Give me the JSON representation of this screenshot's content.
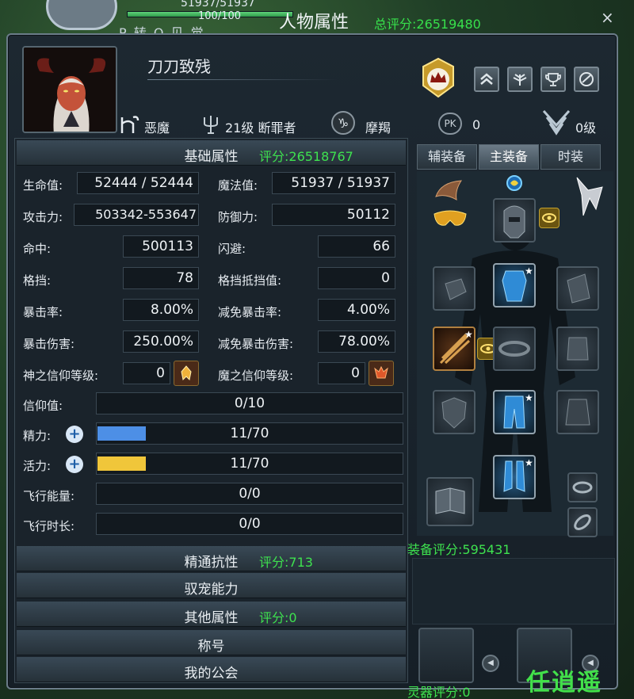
{
  "overlay": {
    "hp_text": "51937/51937",
    "mp_text": "100/100",
    "name_partial": "P 转 Q 见 觉"
  },
  "window": {
    "title": "人物属性",
    "total_score": "总评分:26519480",
    "close_label": "×"
  },
  "character": {
    "name": "刀刀致残",
    "race": "恶魔",
    "class": "21级 断罪者",
    "zodiac": "摩羯",
    "pk_label": "PK",
    "pk_value": "0",
    "rank_value": "0级"
  },
  "basic": {
    "title": "基础属性",
    "score": "评分:26518767",
    "stats": [
      {
        "label": "生命值:",
        "value": "52444 / 52444"
      },
      {
        "label": "魔法值:",
        "value": "51937 / 51937"
      },
      {
        "label": "攻击力:",
        "value": "503342-553647"
      },
      {
        "label": "防御力:",
        "value": "50112"
      },
      {
        "label": "命中:",
        "value": "500113"
      },
      {
        "label": "闪避:",
        "value": "66"
      },
      {
        "label": "格挡:",
        "value": "78"
      },
      {
        "label": "格挡抵挡值:",
        "value": "0"
      },
      {
        "label": "暴击率:",
        "value": "8.00%"
      },
      {
        "label": "减免暴击率:",
        "value": "4.00%"
      },
      {
        "label": "暴击伤害:",
        "value": "250.00%"
      },
      {
        "label": "减免暴击伤害:",
        "value": "78.00%"
      },
      {
        "label": "神之信仰等级:",
        "value": "0"
      },
      {
        "label": "魔之信仰等级:",
        "value": "0"
      }
    ],
    "faith": {
      "label": "信仰值:",
      "value": "0/10"
    },
    "energy": {
      "label": "精力:",
      "value": "11/70",
      "fraction": 0.157,
      "color": "#4d8fe6"
    },
    "vitality": {
      "label": "活力:",
      "value": "11/70",
      "fraction": 0.157,
      "color": "#f0c63a"
    },
    "flight_energy": {
      "label": "飞行能量:",
      "value": "0/0"
    },
    "flight_time": {
      "label": "飞行时长:",
      "value": "0/0"
    }
  },
  "sections": [
    {
      "title": "精通抗性",
      "score": "评分:713"
    },
    {
      "title": "驭宠能力",
      "score": ""
    },
    {
      "title": "其他属性",
      "score": "评分:0"
    },
    {
      "title": "称号",
      "score": ""
    },
    {
      "title": "我的公会",
      "score": ""
    }
  ],
  "equipment": {
    "tabs": [
      "辅装备",
      "主装备",
      "时装"
    ],
    "active_tab": "主装备",
    "score": "装备评分:595431",
    "spirit_score": "灵器评分:0"
  },
  "watermark": "任逍遥",
  "colors": {
    "score_green": "#3ee24f",
    "panel_bg": "#1a232b",
    "energy_blue": "#4d8fe6",
    "vitality_yellow": "#f0c63a"
  }
}
